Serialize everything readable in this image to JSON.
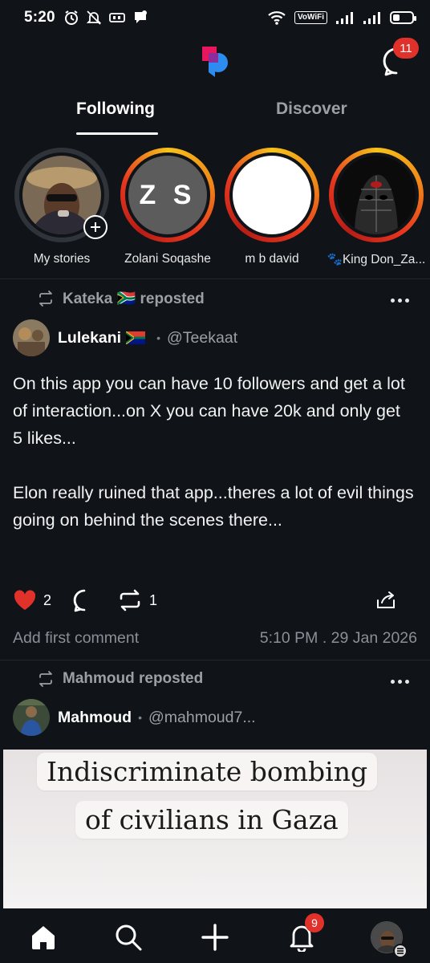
{
  "status_bar": {
    "time": "5:20",
    "vowifi_label": "VoWiFi",
    "battery_level": 0.35
  },
  "header": {
    "logo_icon": "app-logo-icon",
    "messages_icon": "chat-bubble-icon",
    "messages_badge": "11",
    "brand_colors": {
      "pink": "#e8175d",
      "blue": "#2d8cf0"
    }
  },
  "tabs": [
    {
      "label": "Following",
      "active": true
    },
    {
      "label": "Discover",
      "active": false
    }
  ],
  "stories": [
    {
      "label": "My stories",
      "type": "photo",
      "ring": "gray"
    },
    {
      "label": "Zolani Soqashe",
      "initials": "Z S",
      "ring": "live"
    },
    {
      "label": "m b david",
      "ring": "live"
    },
    {
      "label": "🐾King Don_Za...",
      "ring": "live"
    }
  ],
  "post1": {
    "reposted_by": "Kateka 🇿🇦 reposted",
    "author_name": "Lulekani",
    "author_handle": "@Teekaat",
    "text": "On this app you can have 10 followers and get a lot of interaction...on X you can have 20k and only get 5 likes...\n\nElon really ruined that app...theres a lot of evil things going on behind the scenes there...",
    "likes": "2",
    "reposts": "1",
    "comment_placeholder": "Add first comment",
    "timestamp": "5:10 PM . 29 Jan 2026"
  },
  "post2": {
    "reposted_by": "Mahmoud reposted",
    "author_name": "Mahmoud",
    "author_handle": "@mahmoud7...",
    "media_caption_line1": "Indiscriminate bombing",
    "media_caption_line2": "of civilians in Gaza"
  },
  "bottom_nav": {
    "items": [
      "home-icon",
      "search-icon",
      "plus-icon",
      "bell-icon",
      "profile-avatar"
    ],
    "notifications_badge": "9"
  },
  "colors": {
    "background": "#101318",
    "like_red": "#e0312b",
    "badge_red": "#e0312b",
    "muted_text": "#9aa0a6"
  }
}
